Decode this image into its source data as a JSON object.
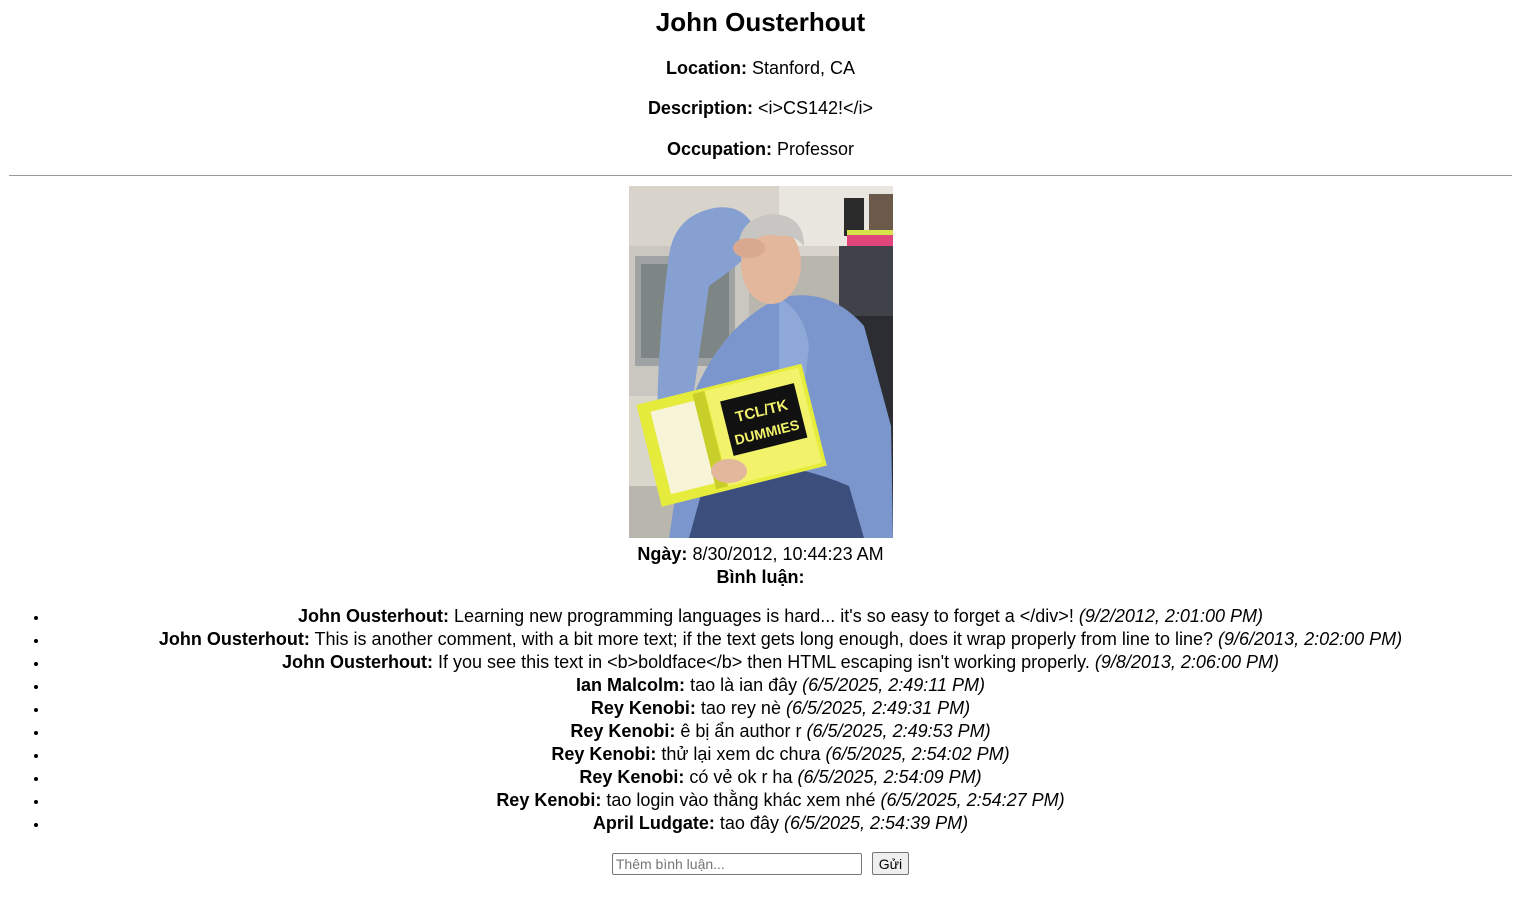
{
  "user": {
    "name": "John Ousterhout",
    "location_label": "Location:",
    "location": "Stanford, CA",
    "description_label": "Description:",
    "description": "<i>CS142!</i>",
    "occupation_label": "Occupation:",
    "occupation": "Professor"
  },
  "photo": {
    "book_title_line1": "TCL/TK",
    "book_title_line2": "DUMMIES",
    "date_label": "Ngày:",
    "date": "8/30/2012, 10:44:23 AM",
    "comments_label": "Bình luận:"
  },
  "comments": [
    {
      "author": "John Ousterhout:",
      "text": "Learning new programming languages is hard... it's so easy to forget a </div>!",
      "date": "(9/2/2012, 2:01:00 PM)"
    },
    {
      "author": "John Ousterhout:",
      "text": "This is another comment, with a bit more text; if the text gets long enough, does it wrap properly from line to line?",
      "date": "(9/6/2013, 2:02:00 PM)"
    },
    {
      "author": "John Ousterhout:",
      "text": "If you see this text in <b>boldface</b> then HTML escaping isn't working properly.",
      "date": "(9/8/2013, 2:06:00 PM)"
    },
    {
      "author": "Ian Malcolm:",
      "text": "tao là ian đây",
      "date": "(6/5/2025, 2:49:11 PM)"
    },
    {
      "author": "Rey Kenobi:",
      "text": "tao rey nè",
      "date": "(6/5/2025, 2:49:31 PM)"
    },
    {
      "author": "Rey Kenobi:",
      "text": "ê bị ẩn author r",
      "date": "(6/5/2025, 2:49:53 PM)"
    },
    {
      "author": "Rey Kenobi:",
      "text": "thử lại xem dc chưa",
      "date": "(6/5/2025, 2:54:02 PM)"
    },
    {
      "author": "Rey Kenobi:",
      "text": "có vẻ ok r ha",
      "date": "(6/5/2025, 2:54:09 PM)"
    },
    {
      "author": "Rey Kenobi:",
      "text": "tao login vào thằng khác xem nhé",
      "date": "(6/5/2025, 2:54:27 PM)"
    },
    {
      "author": "April Ludgate:",
      "text": "tao đây",
      "date": "(6/5/2025, 2:54:39 PM)"
    }
  ],
  "form": {
    "placeholder": "Thêm bình luận...",
    "value": "",
    "submit_label": "Gửi"
  }
}
